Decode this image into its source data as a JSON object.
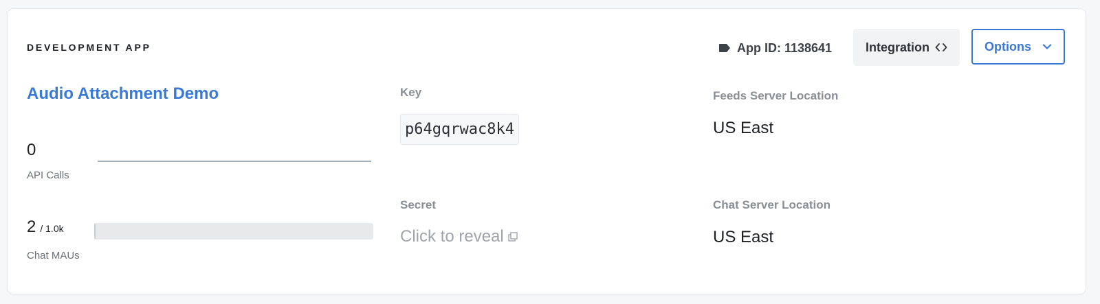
{
  "header": {
    "env_label": "DEVELOPMENT APP",
    "app_id_label": "App ID: 1138641",
    "integration_label": "Integration",
    "options_label": "Options"
  },
  "app": {
    "name": "Audio Attachment Demo"
  },
  "metrics": {
    "api_calls": {
      "value": "0",
      "label": "API Calls"
    },
    "chat_maus": {
      "value": "2",
      "limit": "/ 1.0k",
      "label": "Chat MAUs",
      "usage_fraction": 0.002
    }
  },
  "credentials": {
    "key_label": "Key",
    "key_value": "p64gqrwac8k4",
    "secret_label": "Secret",
    "secret_reveal": "Click to reveal"
  },
  "locations": {
    "feeds_label": "Feeds Server Location",
    "feeds_value": "US East",
    "chat_label": "Chat Server Location",
    "chat_value": "US East"
  },
  "icons": {
    "app_id": "tag-icon",
    "integration": "code-icon",
    "options": "chevron-down-icon",
    "reveal": "external-link-icon"
  },
  "colors": {
    "accent": "#3b79d6",
    "text": "#1d1f23",
    "muted": "#8a8f96"
  }
}
